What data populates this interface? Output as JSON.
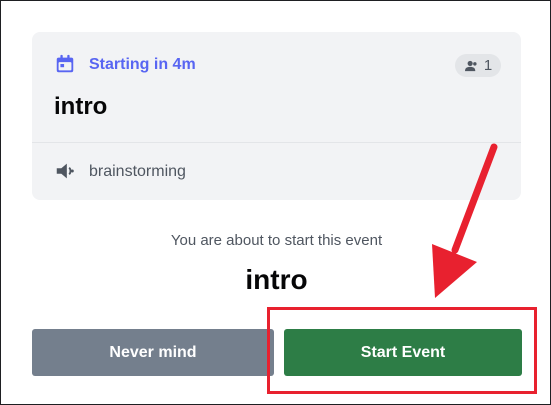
{
  "event_card": {
    "status": "Starting in 4m",
    "interested_count": "1",
    "title": "intro",
    "channel": "brainstorming",
    "icons": [
      "calendar-icon",
      "person-icon",
      "stage-channel-icon"
    ]
  },
  "confirm": {
    "prompt": "You are about to start this event",
    "event_name": "intro"
  },
  "buttons": {
    "cancel_label": "Never mind",
    "start_label": "Start Event"
  },
  "colors": {
    "accent": "#5865f2",
    "start_button": "#2d7d46",
    "cancel_button": "#747f8d",
    "annotation": "#e8212f"
  }
}
